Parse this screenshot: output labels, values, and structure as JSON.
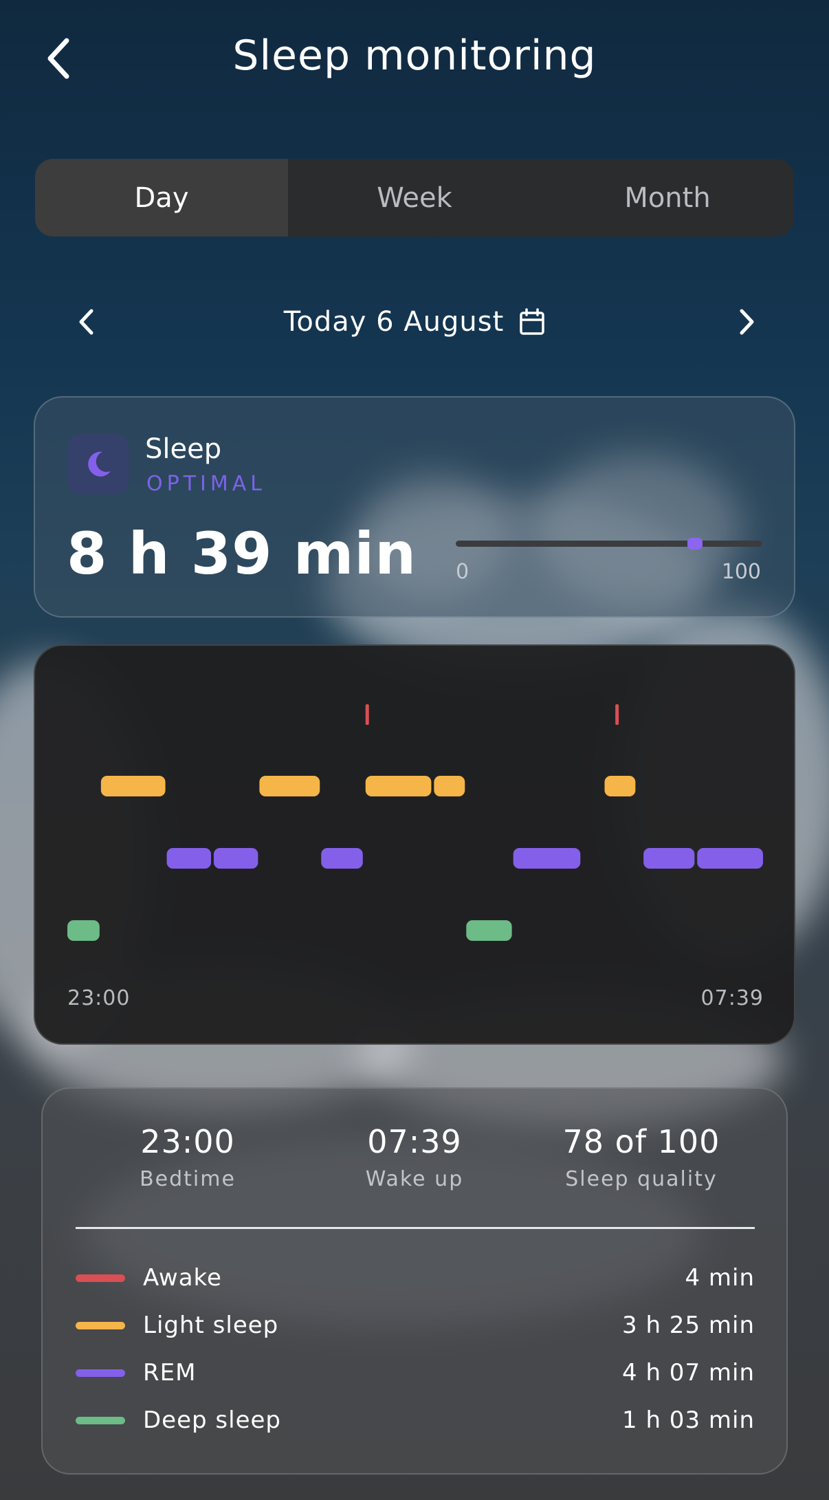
{
  "header": {
    "title": "Sleep monitoring"
  },
  "tabs": [
    {
      "label": "Day",
      "active": true
    },
    {
      "label": "Week",
      "active": false
    },
    {
      "label": "Month",
      "active": false
    }
  ],
  "date_nav": {
    "label": "Today 6 August"
  },
  "sleep_card": {
    "title": "Sleep",
    "status": "OPTIMAL",
    "duration": "8 h 39 min",
    "score": 78,
    "range_min": "0",
    "range_max": "100"
  },
  "colors": {
    "awake": "#d94f54",
    "light": "#f5b548",
    "rem": "#8460ea",
    "deep": "#6dbb87",
    "accent": "#7d62e8"
  },
  "chart_data": {
    "type": "timeline",
    "x_start": "23:00",
    "x_end": "07:39",
    "stages": [
      "Awake",
      "Light sleep",
      "REM",
      "Deep sleep"
    ],
    "segments": [
      {
        "stage": "Deep sleep",
        "start": "23:00",
        "end": "23:25"
      },
      {
        "stage": "Light sleep",
        "start": "23:25",
        "end": "00:14"
      },
      {
        "stage": "REM",
        "start": "00:14",
        "end": "00:48"
      },
      {
        "stage": "REM",
        "start": "00:49",
        "end": "01:23"
      },
      {
        "stage": "Light sleep",
        "start": "01:23",
        "end": "02:09"
      },
      {
        "stage": "REM",
        "start": "02:09",
        "end": "02:41"
      },
      {
        "stage": "Awake",
        "start": "02:42",
        "end": "02:44"
      },
      {
        "stage": "Light sleep",
        "start": "02:42",
        "end": "03:32"
      },
      {
        "stage": "Light sleep",
        "start": "03:33",
        "end": "03:57"
      },
      {
        "stage": "Deep sleep",
        "start": "03:57",
        "end": "04:32"
      },
      {
        "stage": "REM",
        "start": "04:32",
        "end": "05:23"
      },
      {
        "stage": "Light sleep",
        "start": "05:40",
        "end": "06:04"
      },
      {
        "stage": "Awake",
        "start": "05:48",
        "end": "05:50"
      },
      {
        "stage": "REM",
        "start": "06:09",
        "end": "06:48"
      },
      {
        "stage": "REM",
        "start": "06:49",
        "end": "07:39"
      }
    ]
  },
  "summary": {
    "stats": [
      {
        "value": "23:00",
        "label": "Bedtime"
      },
      {
        "value": "07:39",
        "label": "Wake up"
      },
      {
        "value": "78 of 100",
        "label": "Sleep quality"
      }
    ],
    "legend": [
      {
        "name": "Awake",
        "value": "4 min",
        "color": "#d94f54"
      },
      {
        "name": "Light sleep",
        "value": "3 h 25 min",
        "color": "#f5b548"
      },
      {
        "name": "REM",
        "value": "4 h 07 min",
        "color": "#8460ea"
      },
      {
        "name": "Deep sleep",
        "value": "1 h 03 min",
        "color": "#6dbb87"
      }
    ]
  },
  "icons": {
    "back": "chevron-left-icon",
    "prev": "chevron-left-icon",
    "next": "chevron-right-icon",
    "calendar": "calendar-icon",
    "moon": "moon-icon"
  }
}
